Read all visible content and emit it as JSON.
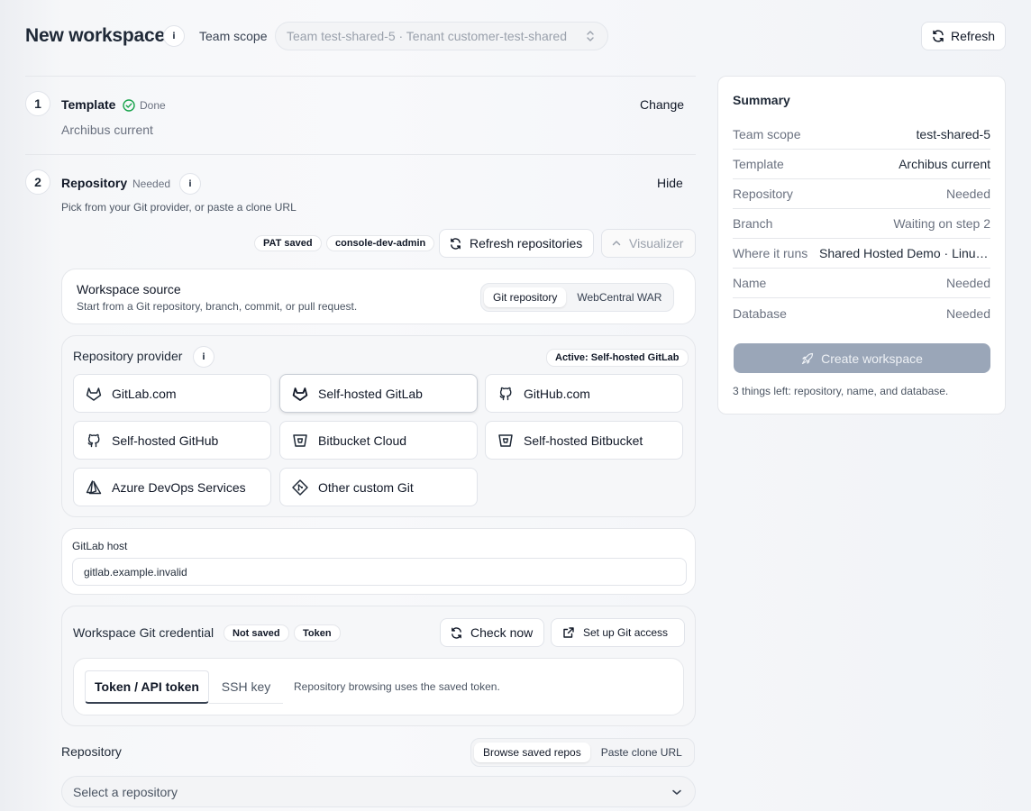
{
  "header": {
    "title": "New workspace",
    "info": "i",
    "scope_label": "Team scope",
    "scope_value": "Team test-shared-5 · Tenant customer-test-shared",
    "refresh": "Refresh"
  },
  "step1": {
    "num": "1",
    "title": "Template",
    "status": "Done",
    "value": "Archibus current",
    "action": "Change"
  },
  "step2": {
    "num": "2",
    "title": "Repository",
    "status": "Needed",
    "info": "i",
    "subtitle": "Pick from your Git provider, or paste a clone URL",
    "action": "Hide",
    "badges": [
      "PAT saved",
      "console-dev-admin"
    ],
    "refresh_repos": "Refresh repositories",
    "visualizer": "Visualizer"
  },
  "source": {
    "title": "Workspace source",
    "desc": "Start from a Git repository, branch, commit, or pull request.",
    "options": [
      "Git repository",
      "WebCentral WAR"
    ],
    "selected": "Git repository"
  },
  "provider": {
    "label": "Repository provider",
    "info": "i",
    "active_badge": "Active: Self-hosted GitLab",
    "items": [
      {
        "label": "GitLab.com",
        "icon": "gitlab-icon"
      },
      {
        "label": "Self-hosted GitLab",
        "icon": "gitlab-icon"
      },
      {
        "label": "GitHub.com",
        "icon": "github-icon"
      },
      {
        "label": "Self-hosted GitHub",
        "icon": "github-icon"
      },
      {
        "label": "Bitbucket Cloud",
        "icon": "bitbucket-icon"
      },
      {
        "label": "Self-hosted Bitbucket",
        "icon": "bitbucket-icon"
      },
      {
        "label": "Azure DevOps Services",
        "icon": "azure-devops-icon"
      },
      {
        "label": "Other custom Git",
        "icon": "git-icon"
      }
    ],
    "selected": "Self-hosted GitLab"
  },
  "host": {
    "label": "GitLab host",
    "value": "gitlab.example.invalid"
  },
  "credential": {
    "title": "Workspace Git credential",
    "badges": [
      "Not saved",
      "Token"
    ],
    "check_now": "Check now",
    "setup": "Set up Git access",
    "tabs": [
      "Token / API token",
      "SSH key"
    ],
    "selected_tab": "Token / API token",
    "note": "Repository browsing uses the saved token."
  },
  "repository": {
    "label": "Repository",
    "modes": [
      "Browse saved repos",
      "Paste clone URL"
    ],
    "selected_mode": "Browse saved repos",
    "placeholder": "Select a repository"
  },
  "summary": {
    "title": "Summary",
    "rows": [
      {
        "key": "Team scope",
        "value": "test-shared-5"
      },
      {
        "key": "Template",
        "value": "Archibus current"
      },
      {
        "key": "Repository",
        "value": "Needed"
      },
      {
        "key": "Branch",
        "value": "Waiting on step 2"
      },
      {
        "key": "Where it runs",
        "value": "Shared Hosted Demo · Linux…"
      },
      {
        "key": "Name",
        "value": "Needed"
      },
      {
        "key": "Database",
        "value": "Needed"
      }
    ],
    "create": "Create workspace",
    "footer": "3 things left: repository, name, and database."
  }
}
